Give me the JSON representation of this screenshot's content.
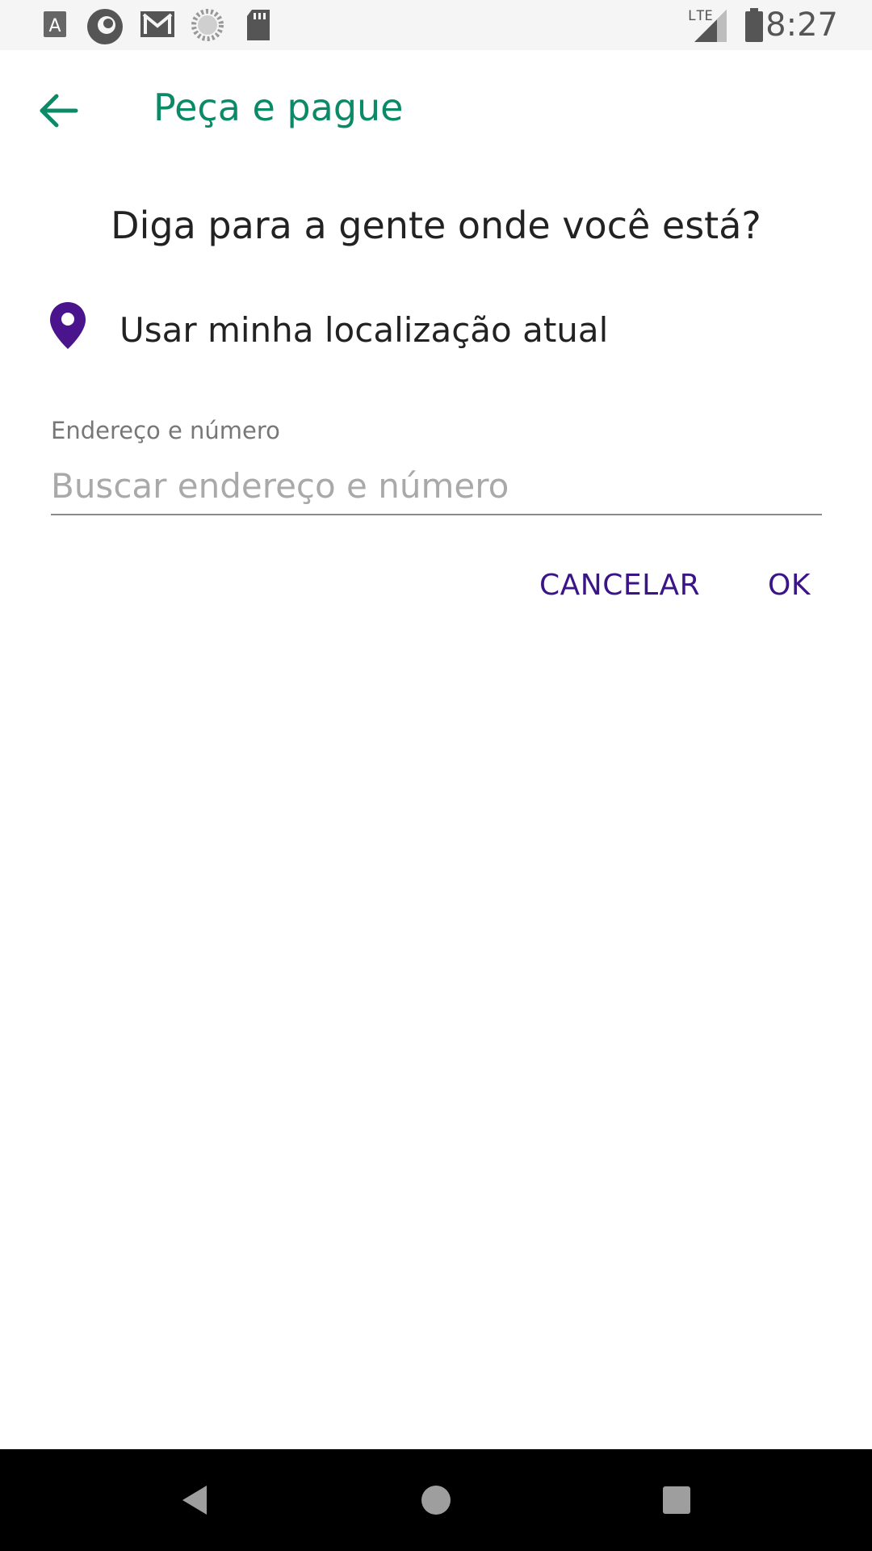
{
  "status_bar": {
    "time": "8:27",
    "network": "LTE",
    "icons": [
      "font-app-icon",
      "camera-app-icon",
      "gmail-icon",
      "loading-icon",
      "sd-card-icon"
    ]
  },
  "toolbar": {
    "title": "Peça e pague",
    "back_icon": "arrow-left-icon"
  },
  "prompt": "Diga para a gente onde você está?",
  "use_location": {
    "label": "Usar minha localização atual",
    "icon": "location-pin-icon"
  },
  "address": {
    "label": "Endereço e número",
    "placeholder": "Buscar endereço e número",
    "value": ""
  },
  "actions": {
    "cancel": "CANCELAR",
    "ok": "OK"
  },
  "colors": {
    "title_green": "#0b8a68",
    "accent_purple": "#3b1587",
    "pin_purple": "#4a148c"
  }
}
